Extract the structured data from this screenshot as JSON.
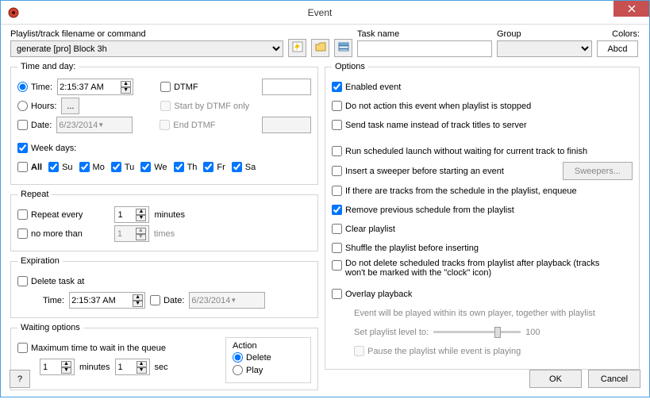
{
  "window": {
    "title": "Event"
  },
  "top": {
    "filename_label": "Playlist/track filename or command",
    "filename_value": "generate [pro] Block 3h",
    "taskname_label": "Task name",
    "taskname_value": "",
    "group_label": "Group",
    "group_value": "",
    "colors_label": "Colors:",
    "colors_sample": "Abcd"
  },
  "timeday": {
    "legend": "Time and day:",
    "time_label": "Time:",
    "time_value": "2:15:37 AM",
    "dtmf_label": "DTMF",
    "dtmf_value": "",
    "hours_label": "Hours:",
    "hours_btn": "...",
    "start_dtmf_label": "Start by DTMF only",
    "date_label": "Date:",
    "date_value": "6/23/2014",
    "end_dtmf_label": "End DTMF",
    "end_dtmf_value": "",
    "weekdays_label": "Week days:",
    "all_label": "All",
    "days": [
      "Su",
      "Mo",
      "Tu",
      "We",
      "Th",
      "Fr",
      "Sa"
    ]
  },
  "repeat": {
    "legend": "Repeat",
    "every_label": "Repeat every",
    "every_value": "1",
    "minutes_label": "minutes",
    "nomore_label": "no more than",
    "nomore_value": "1",
    "times_label": "times"
  },
  "expiration": {
    "legend": "Expiration",
    "delete_label": "Delete task at",
    "time_label": "Time:",
    "time_value": "2:15:37 AM",
    "date_label": "Date:",
    "date_value": "6/23/2014"
  },
  "waiting": {
    "legend": "Waiting options",
    "max_label": "Maximum time to wait in the queue",
    "min_value": "1",
    "min_label": "minutes",
    "sec_value": "1",
    "sec_label": "sec",
    "action_label": "Action",
    "delete_label": "Delete",
    "play_label": "Play"
  },
  "options": {
    "legend": "Options",
    "enabled": "Enabled event",
    "noaction": "Do not action this event when playlist is stopped",
    "sendtask": "Send task name instead of track titles to server",
    "runsched": "Run scheduled launch without waiting for current track to finish",
    "sweeper": "Insert a sweeper before starting an event",
    "sweepers_btn": "Sweepers...",
    "enqueue": "If there are tracks from the schedule in the playlist, enqueue",
    "removeprev": "Remove previous schedule from the playlist",
    "clear": "Clear playlist",
    "shuffle": "Shuffle the playlist before inserting",
    "nodelete": "Do not delete scheduled tracks from playlist after playback (tracks won't be marked with the \"clock\" icon)",
    "overlay": "Overlay playback",
    "overlay_desc": "Event will be played within its own player, together with playlist",
    "setlevel": "Set playlist level to:",
    "level_value": "100",
    "pause": "Pause the playlist while event is playing"
  },
  "footer": {
    "help": "?",
    "ok": "OK",
    "cancel": "Cancel"
  }
}
